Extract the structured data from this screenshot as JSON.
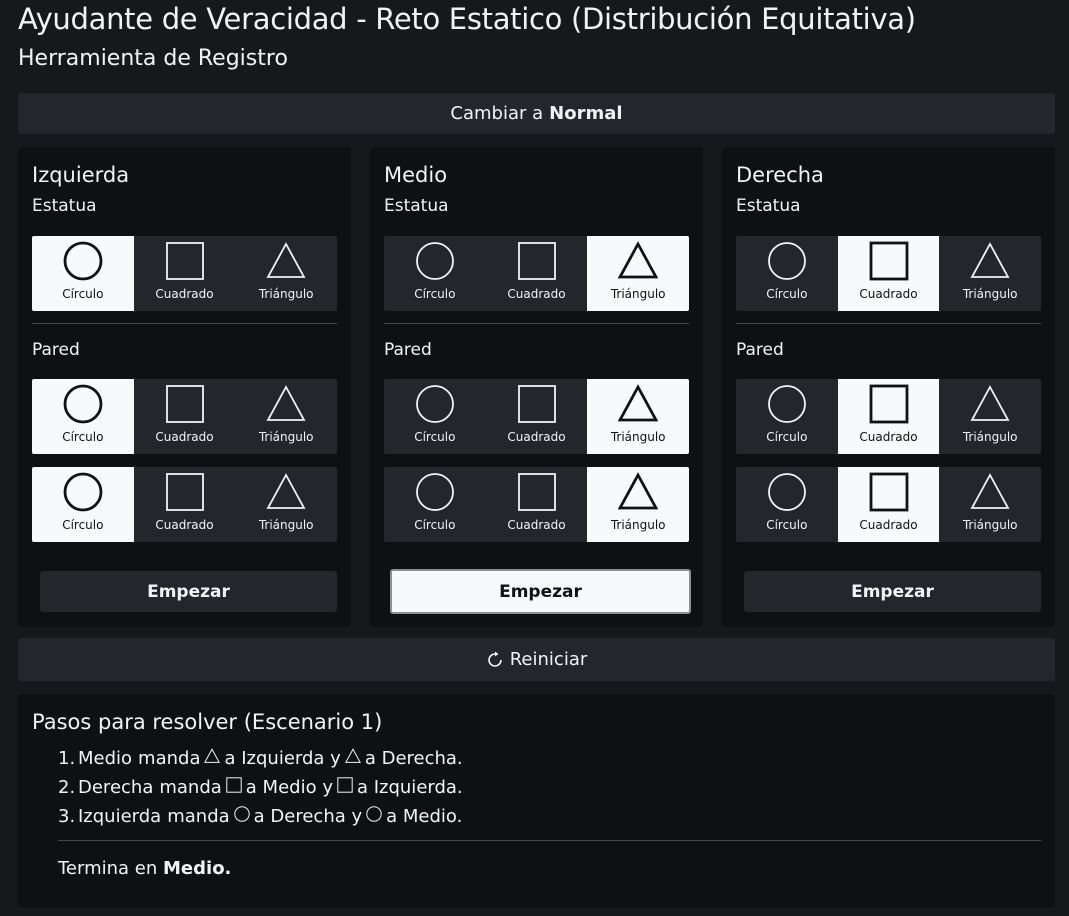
{
  "header": {
    "title": "Ayudante de Veracidad - Reto Estatico (Distribución Equitativa)",
    "subtitle": "Herramienta de Registro"
  },
  "toggle": {
    "prefix": "Cambiar a",
    "mode": "Normal"
  },
  "shape_labels": {
    "circle": "Círculo",
    "square": "Cuadrado",
    "triangle": "Triángulo"
  },
  "section_labels": {
    "statue": "Estatua",
    "wall": "Pared"
  },
  "columns": [
    {
      "name": "Izquierda",
      "statue": "circle",
      "wall_1": "circle",
      "wall_2": "circle",
      "start_label": "Empezar",
      "start_active": false
    },
    {
      "name": "Medio",
      "statue": "triangle",
      "wall_1": "triangle",
      "wall_2": "triangle",
      "start_label": "Empezar",
      "start_active": true
    },
    {
      "name": "Derecha",
      "statue": "square",
      "wall_1": "square",
      "wall_2": "square",
      "start_label": "Empezar",
      "start_active": false
    }
  ],
  "reset": {
    "label": "Reiniciar",
    "icon": "refresh-icon"
  },
  "steps": {
    "title": "Pasos para resolver (Escenario 1)",
    "items": [
      {
        "number": "1.",
        "from": "Medio",
        "verb": "manda",
        "shape": "triangle",
        "to1": "a Izquierda y",
        "to2": "a Derecha."
      },
      {
        "number": "2.",
        "from": "Derecha",
        "verb": "manda",
        "shape": "square",
        "to1": "a Medio y",
        "to2": "a Izquierda."
      },
      {
        "number": "3.",
        "from": "Izquierda",
        "verb": "manda",
        "shape": "circle",
        "to1": "a Derecha y",
        "to2": "a Medio."
      }
    ],
    "final_prefix": "Termina en",
    "final_location": "Medio."
  }
}
